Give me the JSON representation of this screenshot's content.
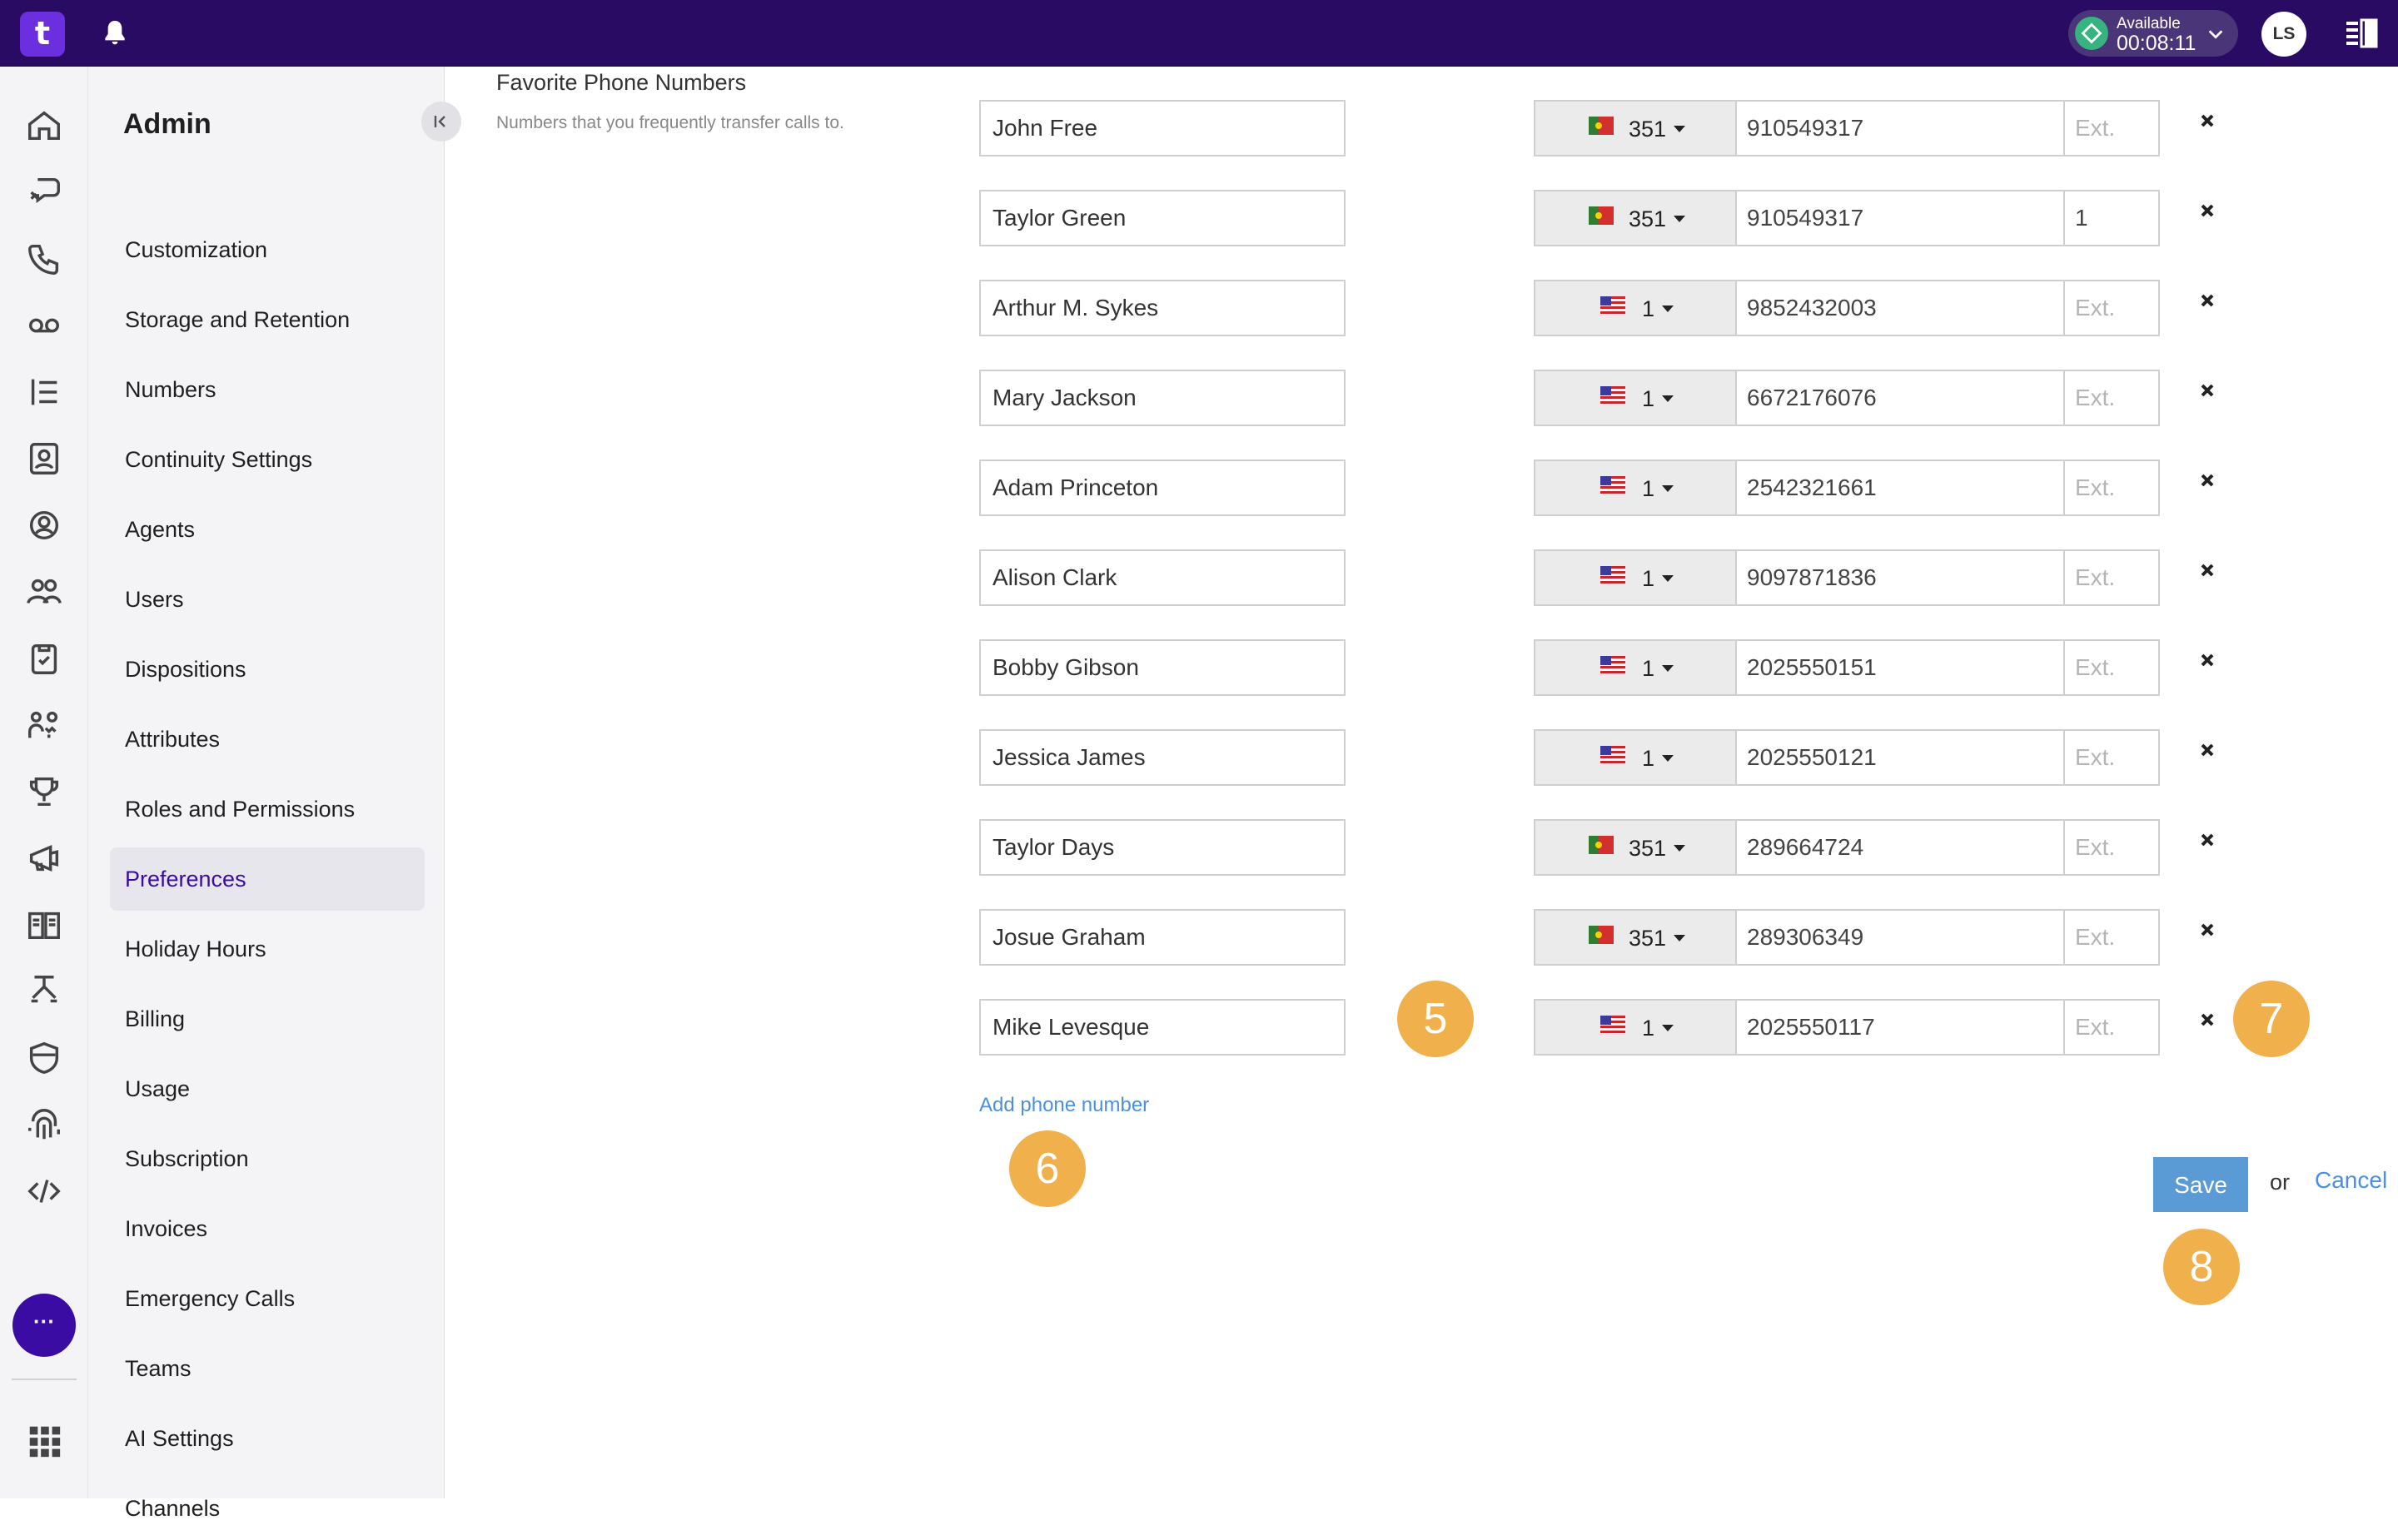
{
  "topbar": {
    "logo": "t",
    "status_label": "Available",
    "status_time": "00:08:11",
    "avatar": "LS"
  },
  "rail": {
    "more_label": "···"
  },
  "sidebar": {
    "title": "Admin",
    "items": [
      {
        "label": "Customization",
        "active": false
      },
      {
        "label": "Storage and Retention",
        "active": false
      },
      {
        "label": "Numbers",
        "active": false
      },
      {
        "label": "Continuity Settings",
        "active": false
      },
      {
        "label": "Agents",
        "active": false
      },
      {
        "label": "Users",
        "active": false
      },
      {
        "label": "Dispositions",
        "active": false
      },
      {
        "label": "Attributes",
        "active": false
      },
      {
        "label": "Roles and Permissions",
        "active": false
      },
      {
        "label": "Preferences",
        "active": true
      },
      {
        "label": "Holiday Hours",
        "active": false
      },
      {
        "label": "Billing",
        "active": false
      },
      {
        "label": "Usage",
        "active": false
      },
      {
        "label": "Subscription",
        "active": false
      },
      {
        "label": "Invoices",
        "active": false
      },
      {
        "label": "Emergency Calls",
        "active": false
      },
      {
        "label": "Teams",
        "active": false
      },
      {
        "label": "AI Settings",
        "active": false
      },
      {
        "label": "Channels",
        "active": false
      }
    ]
  },
  "favorites": {
    "title": "Favorite Phone Numbers",
    "description": "Numbers that you frequently transfer calls to.",
    "ext_placeholder": "Ext.",
    "rows": [
      {
        "name": "John Free",
        "flag": "pt",
        "code": "351",
        "number": "910549317",
        "ext": ""
      },
      {
        "name": "Taylor Green",
        "flag": "pt",
        "code": "351",
        "number": "910549317",
        "ext": "1"
      },
      {
        "name": "Arthur M. Sykes",
        "flag": "us",
        "code": "1",
        "number": "9852432003",
        "ext": ""
      },
      {
        "name": "Mary Jackson",
        "flag": "us",
        "code": "1",
        "number": "6672176076",
        "ext": ""
      },
      {
        "name": "Adam Princeton",
        "flag": "us",
        "code": "1",
        "number": "2542321661",
        "ext": ""
      },
      {
        "name": "Alison Clark",
        "flag": "us",
        "code": "1",
        "number": "9097871836",
        "ext": ""
      },
      {
        "name": "Bobby Gibson",
        "flag": "us",
        "code": "1",
        "number": "2025550151",
        "ext": ""
      },
      {
        "name": "Jessica James",
        "flag": "us",
        "code": "1",
        "number": "2025550121",
        "ext": ""
      },
      {
        "name": "Taylor Days",
        "flag": "pt",
        "code": "351",
        "number": "289664724",
        "ext": ""
      },
      {
        "name": "Josue Graham",
        "flag": "pt",
        "code": "351",
        "number": "289306349",
        "ext": ""
      },
      {
        "name": "Mike Levesque",
        "flag": "us",
        "code": "1",
        "number": "2025550117",
        "ext": ""
      }
    ],
    "add_label": "Add phone number"
  },
  "actions": {
    "save": "Save",
    "or": "or",
    "cancel": "Cancel"
  },
  "badges": [
    "5",
    "6",
    "7",
    "8"
  ],
  "colors": {
    "topbar": "#2a0b63",
    "accent": "#3a0ca3",
    "link": "#4a90e2",
    "badge": "#f0b04b",
    "save": "#5b9bd5",
    "status": "#36b37e"
  }
}
